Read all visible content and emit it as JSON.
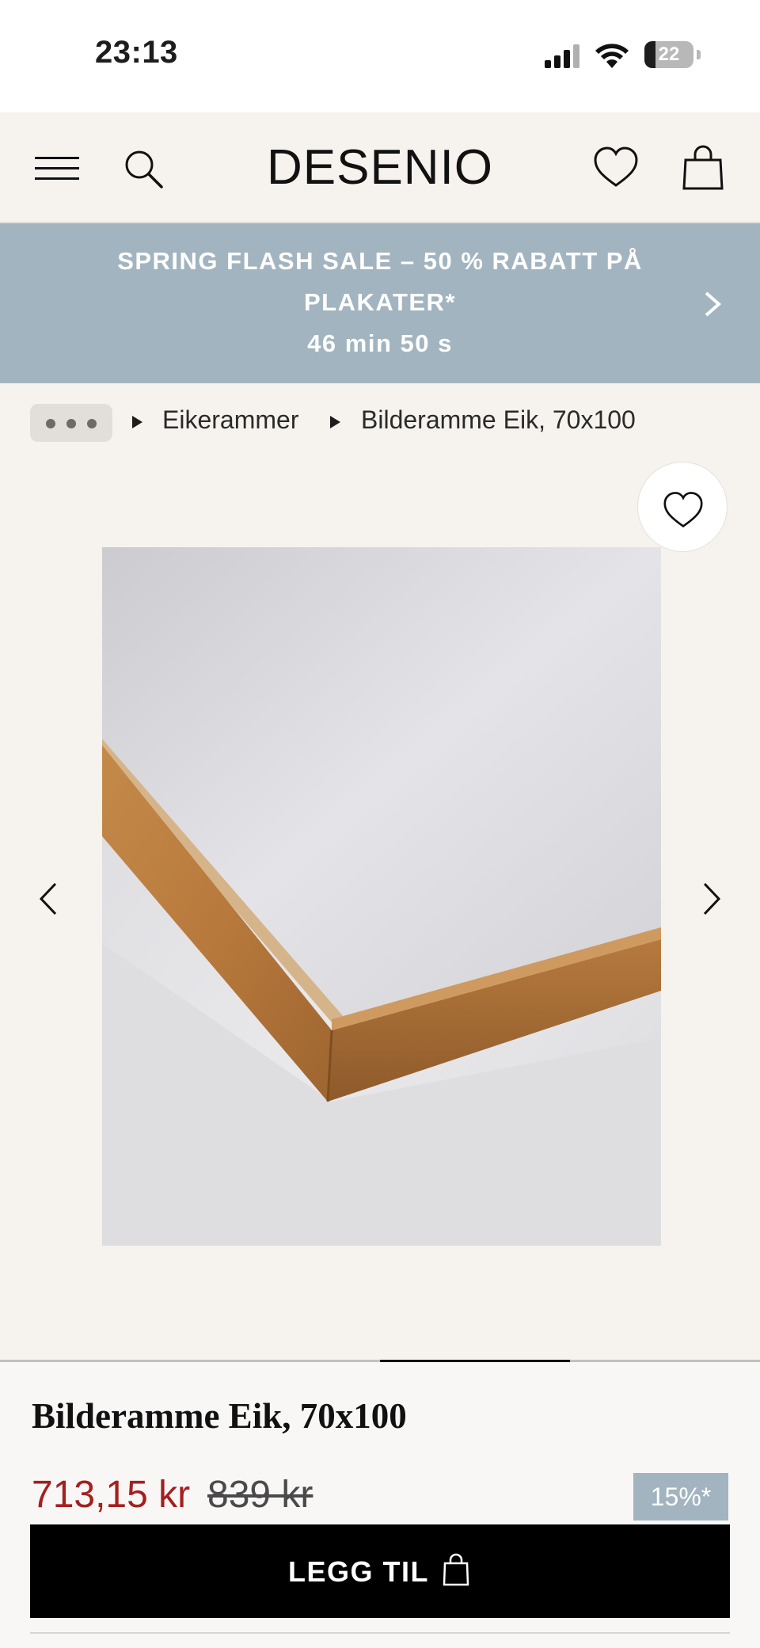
{
  "status_bar": {
    "time": "23:13",
    "battery_level": "22",
    "icons": [
      "signal-icon",
      "wifi-icon",
      "battery-icon"
    ]
  },
  "header": {
    "brand": "DESENIO",
    "icons": [
      "menu-icon",
      "search-icon",
      "heart-icon",
      "shopping-bag-icon"
    ]
  },
  "promo": {
    "text": "SPRING FLASH SALE – 50 % RABATT PÅ PLAKATER*",
    "timer": "46 min 50 s",
    "background": "#a2b4bf"
  },
  "breadcrumb": {
    "items": [
      "Eikerammer",
      "Bilderamme Eik, 70x100"
    ]
  },
  "gallery": {
    "progress": 0.75
  },
  "product": {
    "title": "Bilderamme Eik, 70x100",
    "price_current": "713,15 kr",
    "price_old": "839 kr",
    "discount": "15%*",
    "add_to_cart": "LEGG TIL",
    "price_color": "#a51f1f"
  }
}
